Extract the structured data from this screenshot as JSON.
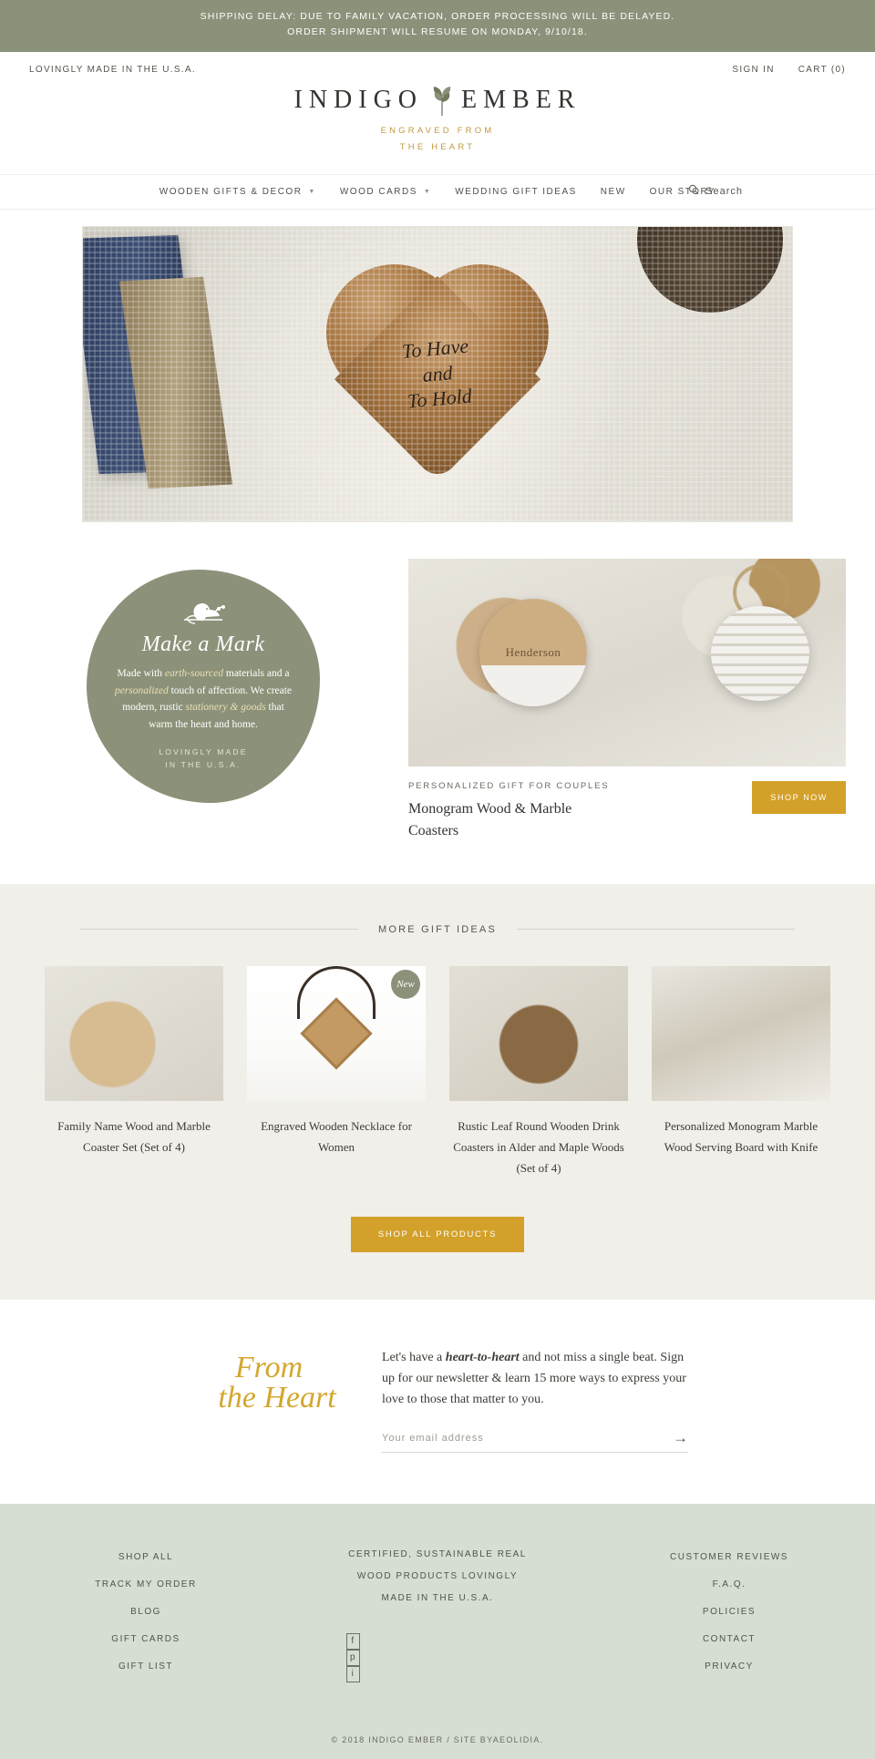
{
  "announcement": {
    "line1": "SHIPPING DELAY: DUE TO FAMILY VACATION, ORDER PROCESSING WILL BE DELAYED.",
    "line2": "ORDER SHIPMENT WILL RESUME ON MONDAY, 9/10/18.",
    "bg": "#8a9279"
  },
  "utility": {
    "tagline": "LOVINGLY MADE IN THE U.S.A.",
    "sign_in": "SIGN IN",
    "cart": "CART (0)"
  },
  "logo": {
    "word_left": "INDIGO",
    "word_right": "EMBER",
    "tagline_line1": "ENGRAVED FROM",
    "tagline_line2": "THE HEART",
    "gold": "#c19a3f"
  },
  "nav": {
    "items": [
      {
        "label": "WOODEN GIFTS & DECOR",
        "has_caret": true
      },
      {
        "label": "WOOD CARDS",
        "has_caret": true
      },
      {
        "label": "WEDDING GIFT IDEAS",
        "has_caret": false
      },
      {
        "label": "NEW",
        "has_caret": false
      },
      {
        "label": "OUR STORY",
        "has_caret": false
      }
    ],
    "search_label": "Search"
  },
  "hero": {
    "script_line1": "To Have",
    "script_line2": "and",
    "script_line3": "To Hold"
  },
  "badge": {
    "heading": "Make a Mark",
    "body_1": "Made with ",
    "body_em1": "earth-sourced",
    "body_2": " materials and a ",
    "body_em2": "personalized",
    "body_3": " touch of affection. We create modern, rustic ",
    "body_em3": "stationery & goods",
    "body_4": " that warm the heart and home.",
    "made_line1": "LOVINGLY MADE",
    "made_line2": "IN THE U.S.A.",
    "bg": "#8c9279"
  },
  "feature": {
    "eyebrow": "PERSONALIZED GIFT FOR COUPLES",
    "title": "Monogram Wood & Marble Coasters",
    "button": "SHOP NOW",
    "monogram": "Henderson",
    "accent": "#d3a029"
  },
  "gifts": {
    "heading": "MORE GIFT IDEAS",
    "new_badge": "New",
    "products": [
      {
        "name": "Family Name Wood and Marble Coaster Set (Set of 4)"
      },
      {
        "name": "Engraved Wooden Necklace for Women"
      },
      {
        "name": "Rustic Leaf Round Wooden Drink Coasters in Alder and Maple Woods (Set of 4)"
      },
      {
        "name": "Personalized Monogram Marble Wood Serving Board with Knife"
      }
    ],
    "shop_all_button": "SHOP ALL PRODUCTS",
    "bg": "#f1efe9"
  },
  "newsletter": {
    "script_line1": "From",
    "script_line2": "the Heart",
    "body_1": "Let's have a ",
    "body_em": "heart-to-heart",
    "body_2": " and not miss a single beat. Sign up for our newsletter & learn 15 more ways to express your love to those that matter to you.",
    "placeholder": "Your email address",
    "value": "",
    "submit_icon": "→"
  },
  "footer": {
    "bg": "#d6ddd2",
    "col_left": [
      "SHOP ALL",
      "TRACK MY ORDER",
      "BLOG",
      "GIFT CARDS",
      "GIFT LIST"
    ],
    "col_mid": [
      "CERTIFIED, SUSTAINABLE REAL",
      "WOOD PRODUCTS LOVINGLY",
      "MADE IN THE U.S.A."
    ],
    "col_right": [
      "CUSTOMER REVIEWS",
      "F.A.Q.",
      "POLICIES",
      "CONTACT",
      "PRIVACY"
    ],
    "social": [
      "f",
      "p",
      "i"
    ],
    "copyright": "© 2018 INDIGO EMBER  /  SITE BYAEOLIDIA."
  }
}
